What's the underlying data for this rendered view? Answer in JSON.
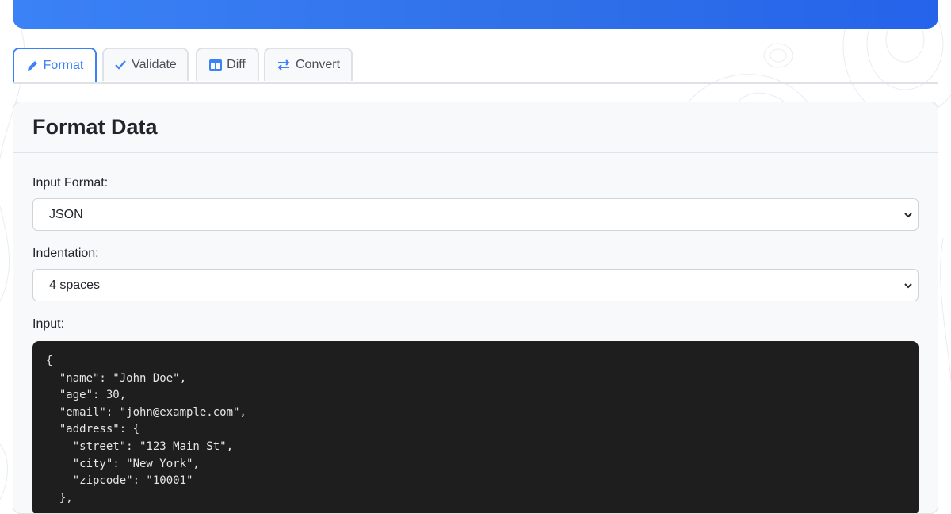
{
  "tabs": [
    {
      "label": "Format",
      "icon": "pencil-icon",
      "active": true
    },
    {
      "label": "Validate",
      "icon": "check-icon",
      "active": false
    },
    {
      "label": "Diff",
      "icon": "columns-icon",
      "active": false
    },
    {
      "label": "Convert",
      "icon": "arrows-exchange-icon",
      "active": false
    }
  ],
  "panel": {
    "title": "Format Data",
    "input_format": {
      "label": "Input Format:",
      "value": "JSON"
    },
    "indentation": {
      "label": "Indentation:",
      "value": "4 spaces"
    },
    "input": {
      "label": "Input:",
      "code": "{\n  \"name\": \"John Doe\",\n  \"age\": 30,\n  \"email\": \"john@example.com\",\n  \"address\": {\n    \"street\": \"123 Main St\",\n    \"city\": \"New York\",\n    \"zipcode\": \"10001\"\n  },"
    }
  },
  "colors": {
    "accent": "#3b82f6",
    "code_background": "#1e1e1e"
  }
}
